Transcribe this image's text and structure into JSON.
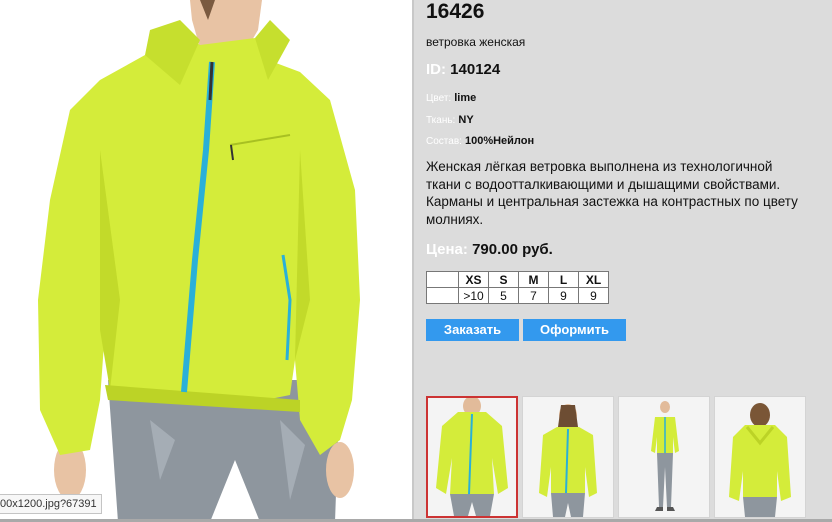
{
  "product": {
    "code": "16426",
    "subtitle": "ветровка женская",
    "id_label": "ID:",
    "id_value": "140124",
    "color_label": "Цвет:",
    "color_value": "lime",
    "fabric_label": "Ткань:",
    "fabric_value": "NY",
    "composition_label": "Состав:",
    "composition_value": "100%Нейлон",
    "description": "Женская  лёгкая ветровка выполнена из технологичной ткани с водоотталкивающими и дышащими свойствами. Карманы и центральная застежка на контрастных по цвету молниях.",
    "price_label": "Цена:",
    "price_value": "790.00 руб."
  },
  "sizes": {
    "headers": [
      "",
      "XS",
      "S",
      "M",
      "L",
      "XL"
    ],
    "values": [
      "",
      ">10",
      "5",
      "7",
      "9",
      "9"
    ]
  },
  "buttons": {
    "order": "Заказать",
    "checkout": "Оформить"
  },
  "status_url": "00x1200.jpg?67391",
  "colors": {
    "button": "#3399ee",
    "jacket": "#d4ec3a",
    "zipper": "#2ab0d8",
    "active_thumb_border": "#cc3333"
  }
}
